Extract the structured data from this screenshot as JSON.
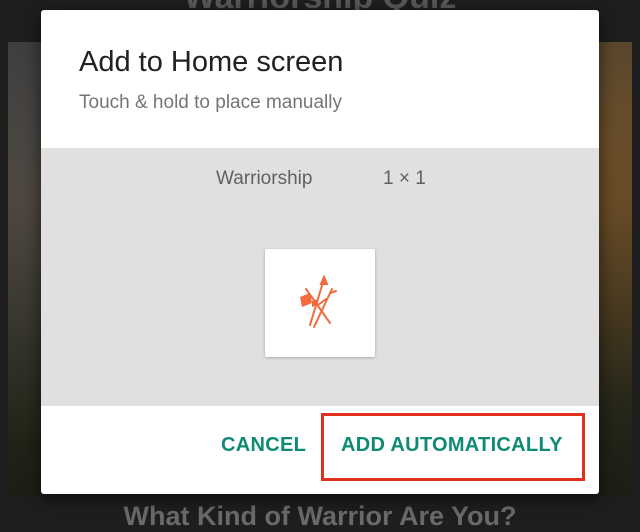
{
  "background": {
    "app_title": "Warriorship Quiz",
    "question": "What Kind of Warrior Are You?"
  },
  "dialog": {
    "title": "Add to Home screen",
    "subtitle": "Touch & hold to place manually",
    "widget": {
      "name": "Warriorship",
      "size": "1 × 1",
      "icon": "warriorship-logo-icon",
      "icon_color": "#f26a3d"
    },
    "actions": {
      "cancel_label": "CANCEL",
      "add_label": "ADD AUTOMATICALLY"
    }
  },
  "colors": {
    "accent": "#0f8a74",
    "highlight": "#e0301e"
  }
}
